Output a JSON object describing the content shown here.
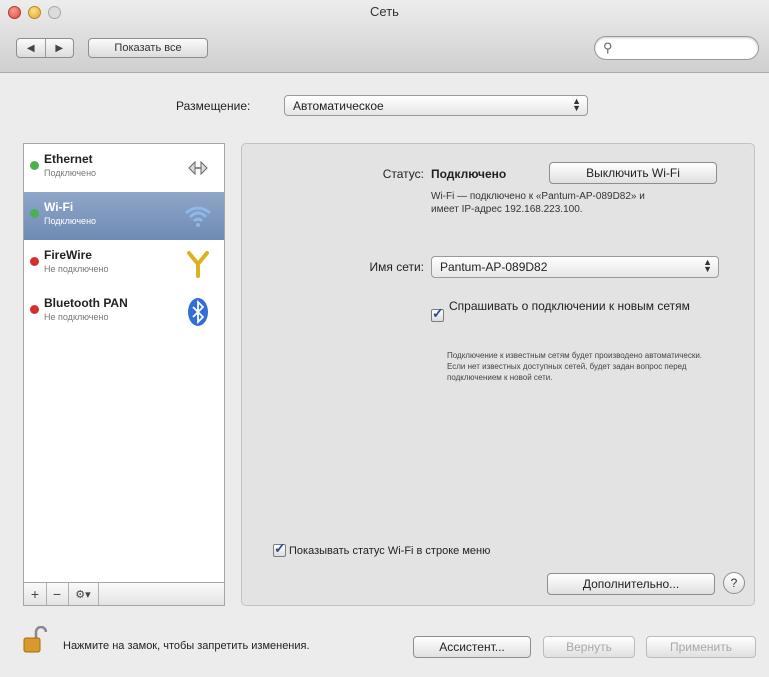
{
  "window": {
    "title": "Сеть"
  },
  "toolbar": {
    "back": "◀",
    "forward": "▶",
    "show_all": "Показать все",
    "search_placeholder": ""
  },
  "location": {
    "label": "Размещение:",
    "value": "Автоматическое"
  },
  "services": [
    {
      "name": "Ethernet",
      "status": "Подключено",
      "icon": "ethernet-icon",
      "dot": "#4caf50",
      "selected": false
    },
    {
      "name": "Wi-Fi",
      "status": "Подключено",
      "icon": "wifi-icon",
      "dot": "#4caf50",
      "selected": true
    },
    {
      "name": "FireWire",
      "status": "Не подключено",
      "icon": "firewire-icon",
      "dot": "#d32f2f",
      "selected": false
    },
    {
      "name": "Bluetooth PAN",
      "status": "Не подключено",
      "icon": "bluetooth-icon",
      "dot": "#d32f2f",
      "selected": false
    }
  ],
  "sidebar_controls": {
    "add": "+",
    "remove": "−",
    "gear": "⚙▾"
  },
  "detail": {
    "status_label": "Статус:",
    "status_value": "Подключено",
    "toggle_wifi": "Выключить Wi-Fi",
    "status_desc": "Wi-Fi — подключено к «Pantum-AP-089D82» и имеет IP-адрес 192.168.223.100.",
    "network_label": "Имя сети:",
    "network_value": "Pantum-AP-089D82",
    "ask_label": "Спрашивать о подключении к новым сетям",
    "ask_checked": true,
    "ask_hint": "Подключение к известным сетям будет производено автоматически. Если нет известных доступных сетей, будет задан вопрос перед подключением к новой сети.",
    "show_status_label": "Показывать статус Wi-Fi в строке меню",
    "show_status_checked": true,
    "advanced": "Дополнительно...",
    "help": "?"
  },
  "footer": {
    "lock_text": "Нажмите на замок, чтобы запретить изменения.",
    "assistant": "Ассистент...",
    "revert": "Вернуть",
    "apply": "Применить"
  },
  "colors": {
    "selection": "#7891ba",
    "connected": "#4caf50",
    "disconnected": "#d32f2f"
  }
}
